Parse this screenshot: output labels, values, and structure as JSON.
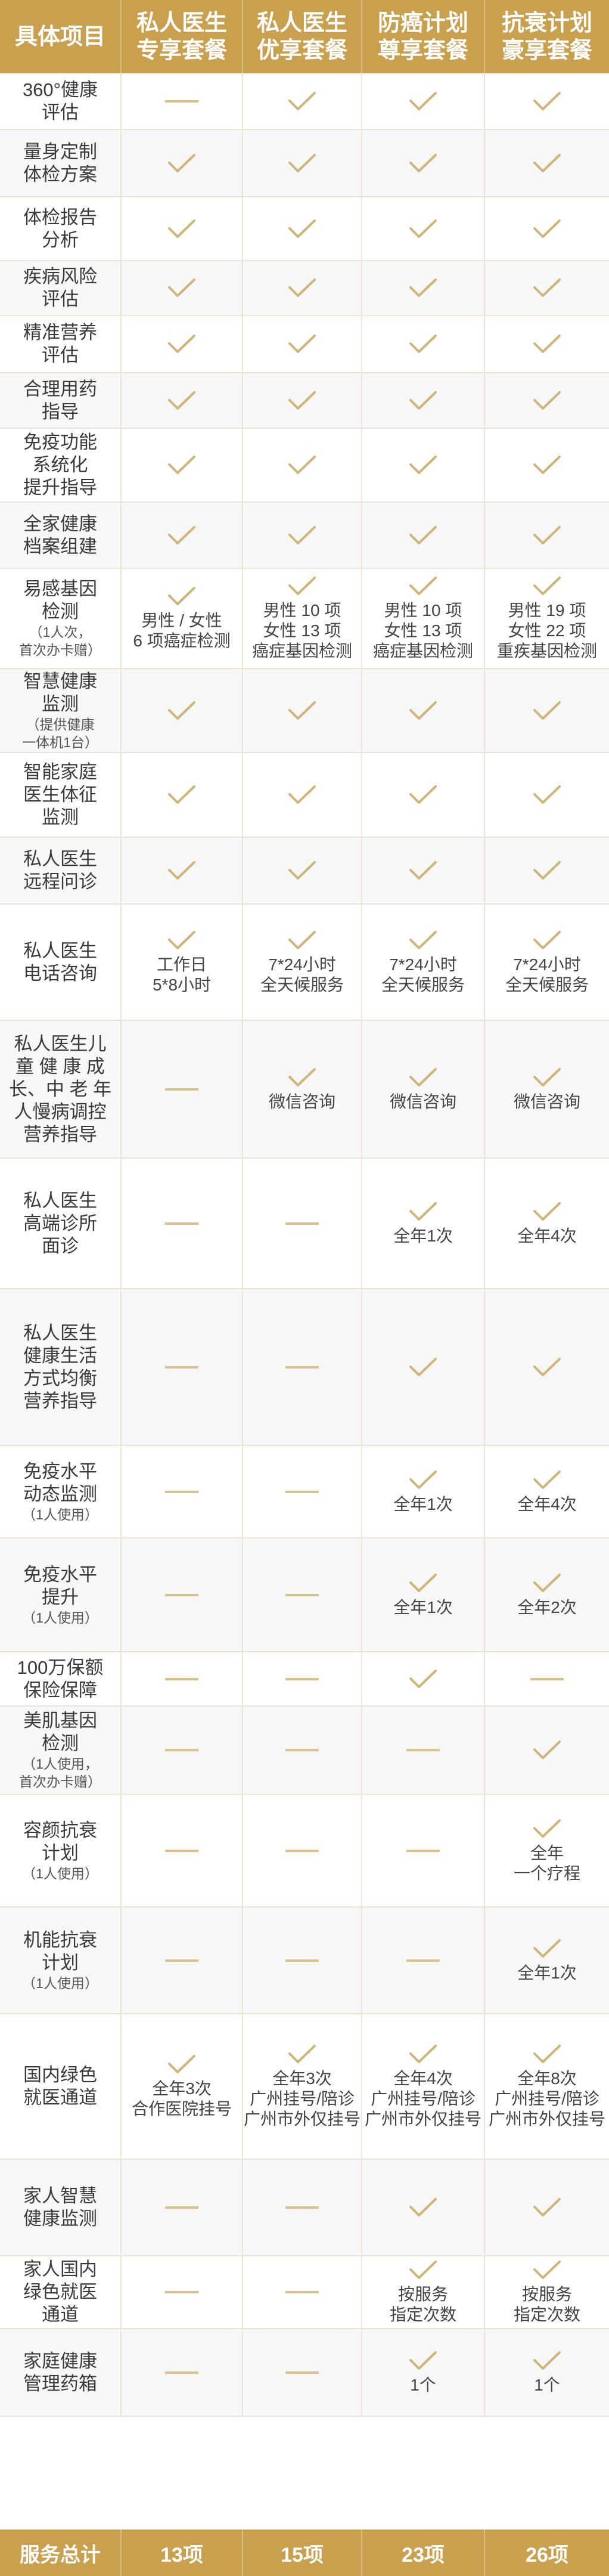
{
  "header": {
    "col0": "具体项目",
    "col1": [
      "私人医生",
      "专享套餐"
    ],
    "col2": [
      "私人医生",
      "优享套餐"
    ],
    "col3": [
      "防癌计划",
      "尊享套餐"
    ],
    "col4": [
      "抗衰计划",
      "豪享套餐"
    ]
  },
  "colors": {
    "gold": "#c8a04e",
    "check": "#cfb57a",
    "dash": "#d8c28e"
  },
  "rows": [
    {
      "name": [
        "360°健康",
        "评估"
      ],
      "sub": [],
      "cells": [
        {
          "m": "dash",
          "t": []
        },
        {
          "m": "check",
          "t": []
        },
        {
          "m": "check",
          "t": []
        },
        {
          "m": "check",
          "t": []
        }
      ]
    },
    {
      "name": [
        "量身定制",
        "体检方案"
      ],
      "sub": [],
      "cells": [
        {
          "m": "check",
          "t": []
        },
        {
          "m": "check",
          "t": []
        },
        {
          "m": "check",
          "t": []
        },
        {
          "m": "check",
          "t": []
        }
      ]
    },
    {
      "name": [
        "体检报告",
        "分析"
      ],
      "sub": [],
      "cells": [
        {
          "m": "check",
          "t": []
        },
        {
          "m": "check",
          "t": []
        },
        {
          "m": "check",
          "t": []
        },
        {
          "m": "check",
          "t": []
        }
      ]
    },
    {
      "name": [
        "疾病风险",
        "评估"
      ],
      "sub": [],
      "cells": [
        {
          "m": "check",
          "t": []
        },
        {
          "m": "check",
          "t": []
        },
        {
          "m": "check",
          "t": []
        },
        {
          "m": "check",
          "t": []
        }
      ]
    },
    {
      "name": [
        "精准营养",
        "评估"
      ],
      "sub": [],
      "cells": [
        {
          "m": "check",
          "t": []
        },
        {
          "m": "check",
          "t": []
        },
        {
          "m": "check",
          "t": []
        },
        {
          "m": "check",
          "t": []
        }
      ]
    },
    {
      "name": [
        "合理用药",
        "指导"
      ],
      "sub": [],
      "cells": [
        {
          "m": "check",
          "t": []
        },
        {
          "m": "check",
          "t": []
        },
        {
          "m": "check",
          "t": []
        },
        {
          "m": "check",
          "t": []
        }
      ]
    },
    {
      "name": [
        "免疫功能",
        "系统化",
        "提升指导"
      ],
      "sub": [],
      "cells": [
        {
          "m": "check",
          "t": []
        },
        {
          "m": "check",
          "t": []
        },
        {
          "m": "check",
          "t": []
        },
        {
          "m": "check",
          "t": []
        }
      ]
    },
    {
      "name": [
        "全家健康",
        "档案组建"
      ],
      "sub": [],
      "cells": [
        {
          "m": "check",
          "t": []
        },
        {
          "m": "check",
          "t": []
        },
        {
          "m": "check",
          "t": []
        },
        {
          "m": "check",
          "t": []
        }
      ]
    },
    {
      "name": [
        "易感基因",
        "检测"
      ],
      "sub": [
        "（1人次，",
        "首次办卡赠）"
      ],
      "cells": [
        {
          "m": "check",
          "t": [
            "男性 / 女性",
            "6 项癌症检测"
          ]
        },
        {
          "m": "check",
          "t": [
            "男性 10 项",
            "女性 13 项",
            "癌症基因检测"
          ]
        },
        {
          "m": "check",
          "t": [
            "男性 10 项",
            "女性 13 项",
            "癌症基因检测"
          ]
        },
        {
          "m": "check",
          "t": [
            "男性 19 项",
            "女性 22 项",
            "重疾基因检测"
          ]
        }
      ]
    },
    {
      "name": [
        "智慧健康",
        "监测"
      ],
      "sub": [
        "（提供健康",
        "一体机1台）"
      ],
      "cells": [
        {
          "m": "check",
          "t": []
        },
        {
          "m": "check",
          "t": []
        },
        {
          "m": "check",
          "t": []
        },
        {
          "m": "check",
          "t": []
        }
      ]
    },
    {
      "name": [
        "智能家庭",
        "医生体征",
        "监测"
      ],
      "sub": [],
      "cells": [
        {
          "m": "check",
          "t": []
        },
        {
          "m": "check",
          "t": []
        },
        {
          "m": "check",
          "t": []
        },
        {
          "m": "check",
          "t": []
        }
      ]
    },
    {
      "name": [
        "私人医生",
        "远程问诊"
      ],
      "sub": [],
      "cells": [
        {
          "m": "check",
          "t": []
        },
        {
          "m": "check",
          "t": []
        },
        {
          "m": "check",
          "t": []
        },
        {
          "m": "check",
          "t": []
        }
      ]
    },
    {
      "name": [
        "私人医生",
        "电话咨询"
      ],
      "sub": [],
      "cells": [
        {
          "m": "check",
          "t": [
            "工作日",
            "5*8小时"
          ]
        },
        {
          "m": "check",
          "t": [
            "7*24小时",
            "全天候服务"
          ]
        },
        {
          "m": "check",
          "t": [
            "7*24小时",
            "全天候服务"
          ]
        },
        {
          "m": "check",
          "t": [
            "7*24小时",
            "全天候服务"
          ]
        }
      ]
    },
    {
      "name": [
        "私人医生儿",
        "童 健 康 成",
        "长、中 老 年",
        "人慢病调控",
        "营养指导"
      ],
      "sub": [],
      "cells": [
        {
          "m": "dash",
          "t": []
        },
        {
          "m": "check",
          "t": [
            "微信咨询"
          ]
        },
        {
          "m": "check",
          "t": [
            "微信咨询"
          ]
        },
        {
          "m": "check",
          "t": [
            "微信咨询"
          ]
        }
      ]
    },
    {
      "name": [
        "私人医生",
        "高端诊所",
        "面诊"
      ],
      "sub": [],
      "cells": [
        {
          "m": "dash",
          "t": []
        },
        {
          "m": "dash",
          "t": []
        },
        {
          "m": "check",
          "t": [
            "全年1次"
          ]
        },
        {
          "m": "check",
          "t": [
            "全年4次"
          ]
        }
      ]
    },
    {
      "name": [
        "私人医生",
        "健康生活",
        "方式均衡",
        "营养指导"
      ],
      "sub": [],
      "cells": [
        {
          "m": "dash",
          "t": []
        },
        {
          "m": "dash",
          "t": []
        },
        {
          "m": "check",
          "t": []
        },
        {
          "m": "check",
          "t": []
        }
      ]
    },
    {
      "name": [
        "免疫水平",
        "动态监测"
      ],
      "sub": [
        "（1人使用）"
      ],
      "cells": [
        {
          "m": "dash",
          "t": []
        },
        {
          "m": "dash",
          "t": []
        },
        {
          "m": "check",
          "t": [
            "全年1次"
          ]
        },
        {
          "m": "check",
          "t": [
            "全年4次"
          ]
        }
      ]
    },
    {
      "name": [
        "免疫水平",
        "提升"
      ],
      "sub": [
        "（1人使用）"
      ],
      "cells": [
        {
          "m": "dash",
          "t": []
        },
        {
          "m": "dash",
          "t": []
        },
        {
          "m": "check",
          "t": [
            "全年1次"
          ]
        },
        {
          "m": "check",
          "t": [
            "全年2次"
          ]
        }
      ]
    },
    {
      "name": [
        "100万保额",
        "保险保障"
      ],
      "sub": [],
      "cells": [
        {
          "m": "dash",
          "t": []
        },
        {
          "m": "dash",
          "t": []
        },
        {
          "m": "check",
          "t": []
        },
        {
          "m": "dash",
          "t": []
        }
      ]
    },
    {
      "name": [
        "美肌基因",
        "检测"
      ],
      "sub": [
        "（1人使用，",
        "首次办卡赠）"
      ],
      "cells": [
        {
          "m": "dash",
          "t": []
        },
        {
          "m": "dash",
          "t": []
        },
        {
          "m": "dash",
          "t": []
        },
        {
          "m": "check",
          "t": []
        }
      ]
    },
    {
      "name": [
        "容颜抗衰",
        "计划"
      ],
      "sub": [
        "（1人使用）"
      ],
      "cells": [
        {
          "m": "dash",
          "t": []
        },
        {
          "m": "dash",
          "t": []
        },
        {
          "m": "dash",
          "t": []
        },
        {
          "m": "check",
          "t": [
            "全年",
            "一个疗程"
          ]
        }
      ]
    },
    {
      "name": [
        "机能抗衰",
        "计划"
      ],
      "sub": [
        "（1人使用）"
      ],
      "cells": [
        {
          "m": "dash",
          "t": []
        },
        {
          "m": "dash",
          "t": []
        },
        {
          "m": "dash",
          "t": []
        },
        {
          "m": "check",
          "t": [
            "全年1次"
          ]
        }
      ]
    },
    {
      "name": [
        "国内绿色",
        "就医通道"
      ],
      "sub": [],
      "cells": [
        {
          "m": "check",
          "t": [
            "全年3次",
            "合作医院挂号"
          ]
        },
        {
          "m": "check",
          "t": [
            "全年3次",
            "广州挂号/陪诊",
            "广州市外仅挂号"
          ]
        },
        {
          "m": "check",
          "t": [
            "全年4次",
            "广州挂号/陪诊",
            "广州市外仅挂号"
          ]
        },
        {
          "m": "check",
          "t": [
            "全年8次",
            "广州挂号/陪诊",
            "广州市外仅挂号"
          ]
        }
      ]
    },
    {
      "name": [
        "家人智慧",
        "健康监测"
      ],
      "sub": [],
      "cells": [
        {
          "m": "dash",
          "t": []
        },
        {
          "m": "dash",
          "t": []
        },
        {
          "m": "check",
          "t": []
        },
        {
          "m": "check",
          "t": []
        }
      ]
    },
    {
      "name": [
        "家人国内",
        "绿色就医",
        "通道"
      ],
      "sub": [],
      "cells": [
        {
          "m": "dash",
          "t": []
        },
        {
          "m": "dash",
          "t": []
        },
        {
          "m": "check",
          "t": [
            "按服务",
            "指定次数"
          ]
        },
        {
          "m": "check",
          "t": [
            "按服务",
            "指定次数"
          ]
        }
      ]
    },
    {
      "name": [
        "家庭健康",
        "管理药箱"
      ],
      "sub": [],
      "cells": [
        {
          "m": "dash",
          "t": []
        },
        {
          "m": "dash",
          "t": []
        },
        {
          "m": "check",
          "t": [
            "1个"
          ]
        },
        {
          "m": "check",
          "t": [
            "1个"
          ]
        }
      ]
    }
  ],
  "footer": {
    "label": "服务总计",
    "values": [
      "13项",
      "15项",
      "23项",
      "26项"
    ]
  }
}
